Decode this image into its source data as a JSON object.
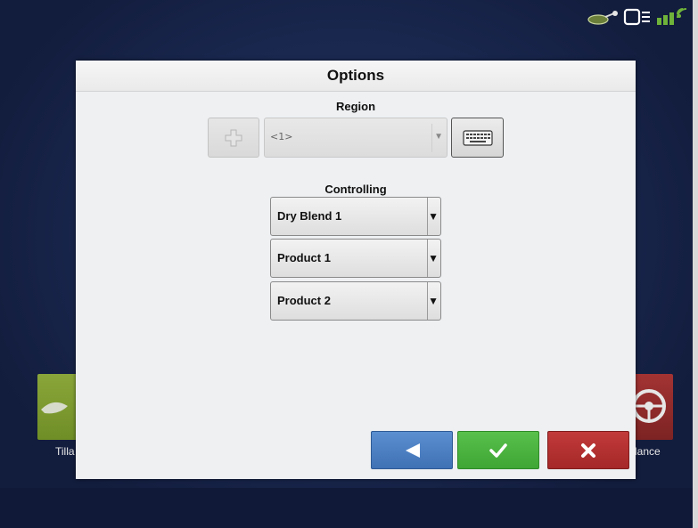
{
  "dialog": {
    "title": "Options",
    "region": {
      "label": "Region",
      "selected": "<1>"
    },
    "controlling": {
      "label": "Controlling",
      "products": [
        "Dry Blend 1",
        "Product 1",
        "Product 2"
      ]
    }
  },
  "background": {
    "left_tile_label": "Tilla",
    "right_tile_label": "lance"
  },
  "status_icons": [
    "implement-icon",
    "display-icon",
    "gps-signal-icon"
  ],
  "colors": {
    "back": "#4a7fc4",
    "accept": "#4cb441",
    "cancel": "#b03030"
  }
}
